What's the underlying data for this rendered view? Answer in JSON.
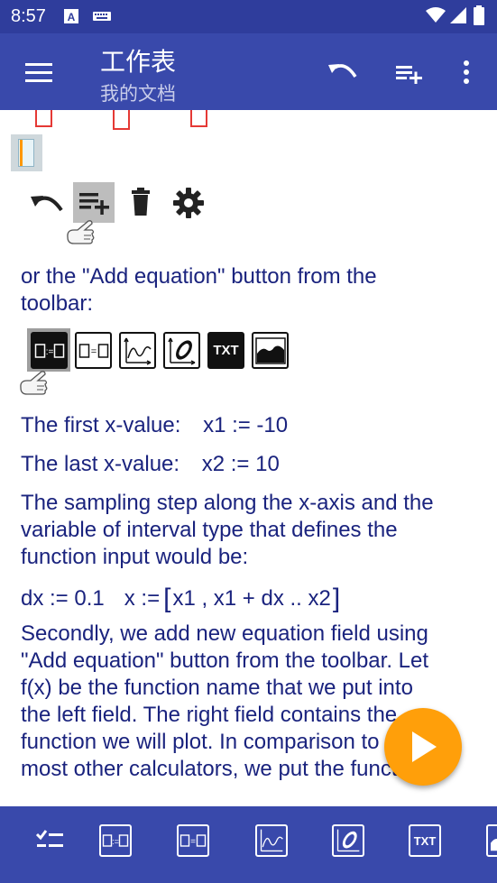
{
  "status": {
    "time": "8:57"
  },
  "appbar": {
    "title": "工作表",
    "subtitle": "我的文档"
  },
  "content": {
    "para1": "or the \"Add equation\" button from the toolbar:",
    "first_x_label": "The first x-value:",
    "first_x_expr": "x1 := -10",
    "last_x_label": "The last x-value:",
    "last_x_expr": "x2 := 10",
    "para2": "The sampling step along the x-axis and the variable of interval type that defines the function input would be:",
    "dx_expr": "dx := 0.1",
    "x_lhs": "x :=",
    "x_rhs": "x1 , x1 + dx .. x2",
    "para3": "Secondly, we add new equation field using \"Add equation\" button from the toolbar. Let f(x) be the function name that we put into the left field. The right field contains the function we will plot. In comparison to the most other calculators, we put the function"
  },
  "toolbar_inline": {
    "txt_label": "TXT"
  },
  "bottombar": {
    "txt_label": "TXT"
  },
  "colors": {
    "primary": "#3949ab",
    "primary_dark": "#2f3d9c",
    "accent": "#ff9f0a",
    "text": "#1a237e"
  }
}
